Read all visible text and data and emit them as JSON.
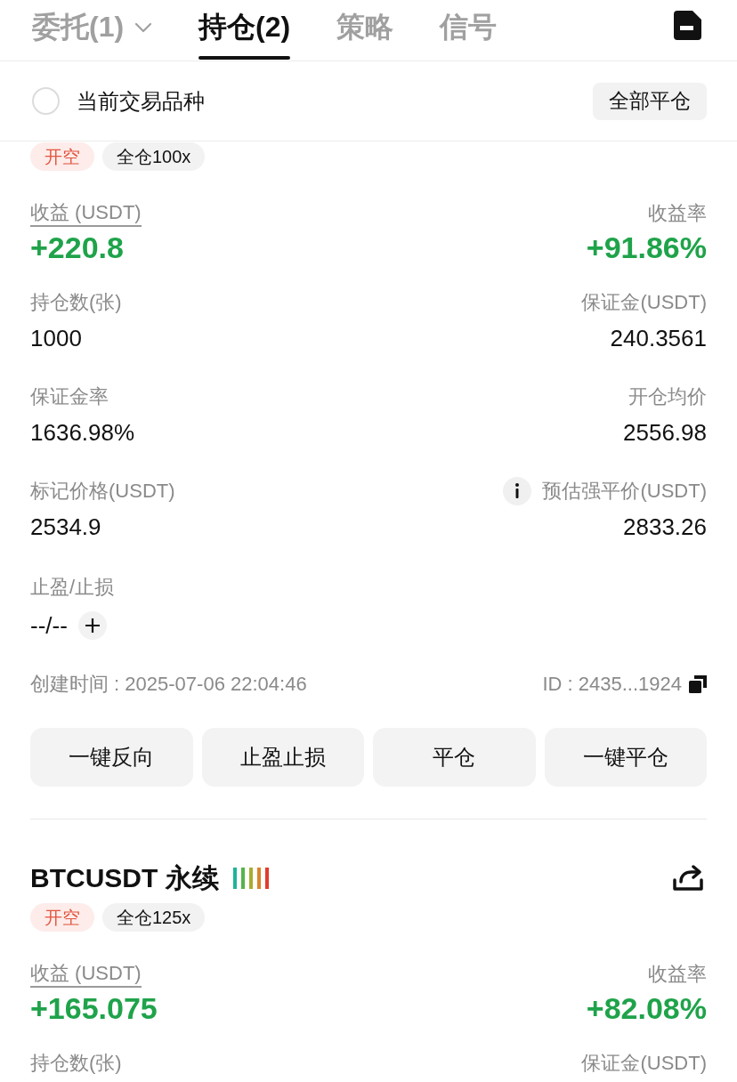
{
  "tabs": [
    {
      "label": "委托(1)",
      "selected": false,
      "dropdown": true
    },
    {
      "label": "持仓(2)",
      "selected": true,
      "dropdown": false
    },
    {
      "label": "策略",
      "selected": false,
      "dropdown": false
    },
    {
      "label": "信号",
      "selected": false,
      "dropdown": false
    }
  ],
  "filter": {
    "label": "当前交易品种",
    "checked": false,
    "button": "全部平仓"
  },
  "positions": [
    {
      "tags": [
        {
          "kind": "side",
          "label": "开空"
        },
        {
          "kind": "leverage",
          "label": "全仓100x"
        }
      ],
      "rows": [
        {
          "left": {
            "label": "收益 (USDT)",
            "value": "+220.8",
            "kind": "pnl",
            "underlined": true
          },
          "right": {
            "label": "收益率",
            "value": "+91.86%",
            "kind": "pnl"
          }
        },
        {
          "left": {
            "label": "持仓数(张)",
            "value": "1000",
            "kind": "plain"
          },
          "right": {
            "label": "保证金(USDT)",
            "value": "240.3561",
            "kind": "plain"
          }
        },
        {
          "left": {
            "label": "保证金率",
            "value": "1636.98%",
            "kind": "plain"
          },
          "right": {
            "label": "开仓均价",
            "value": "2556.98",
            "kind": "plain"
          }
        },
        {
          "left": {
            "label": "标记价格(USDT)",
            "value": "2534.9",
            "kind": "plain"
          },
          "right": {
            "label": "预估强平价(USDT)",
            "value": "2833.26",
            "kind": "plain",
            "info": true
          }
        }
      ],
      "tp_sl": {
        "label": "止盈/止损",
        "value": "--/--"
      },
      "created": "创建时间 : 2025-07-06 22:04:46",
      "id": "ID : 2435...1924",
      "actions": [
        "一键反向",
        "止盈止损",
        "平仓",
        "一键平仓"
      ]
    },
    {
      "title": "BTCUSDT 永续",
      "tags": [
        {
          "kind": "side",
          "label": "开空"
        },
        {
          "kind": "leverage",
          "label": "全仓125x"
        }
      ],
      "rows": [
        {
          "left": {
            "label": "收益 (USDT)",
            "value": "+165.075",
            "kind": "pnl",
            "underlined": true
          },
          "right": {
            "label": "收益率",
            "value": "+82.08%",
            "kind": "pnl"
          }
        },
        {
          "left": {
            "label": "持仓数(张)"
          },
          "right": {
            "label": "保证金(USDT)"
          }
        }
      ]
    }
  ]
}
